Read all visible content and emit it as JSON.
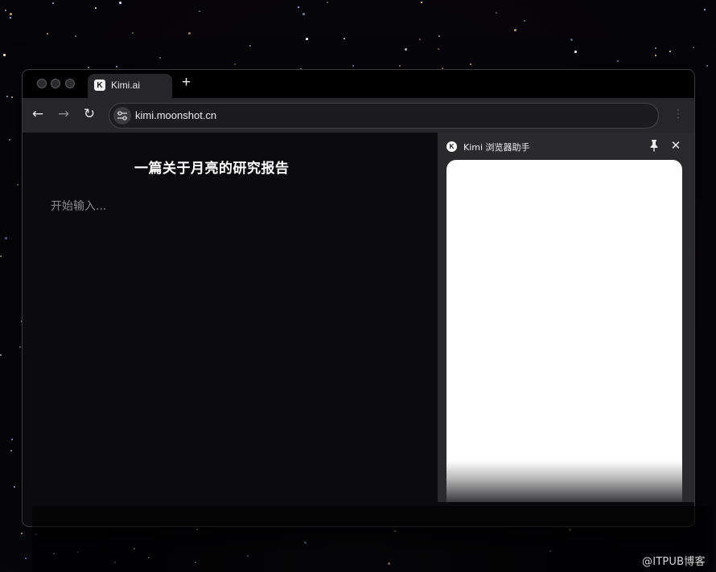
{
  "browser": {
    "tab": {
      "favicon": "K",
      "title": "Kimi.ai"
    },
    "new_tab_label": "+",
    "nav": {
      "back": "←",
      "forward": "→",
      "reload": "↻"
    },
    "address_bar": {
      "url": "kimi.moonshot.cn"
    },
    "menu_label": "⋮"
  },
  "document": {
    "title": "一篇关于月亮的研究报告",
    "placeholder": "开始输入..."
  },
  "side_panel": {
    "logo": "K",
    "title": "Kimi 浏览器助手",
    "close_label": "✕"
  },
  "watermark": "@ITPUB博客",
  "colors": {
    "background": "#07060a",
    "tab_active": "#262628",
    "side_panel": "#2a2a2c"
  }
}
